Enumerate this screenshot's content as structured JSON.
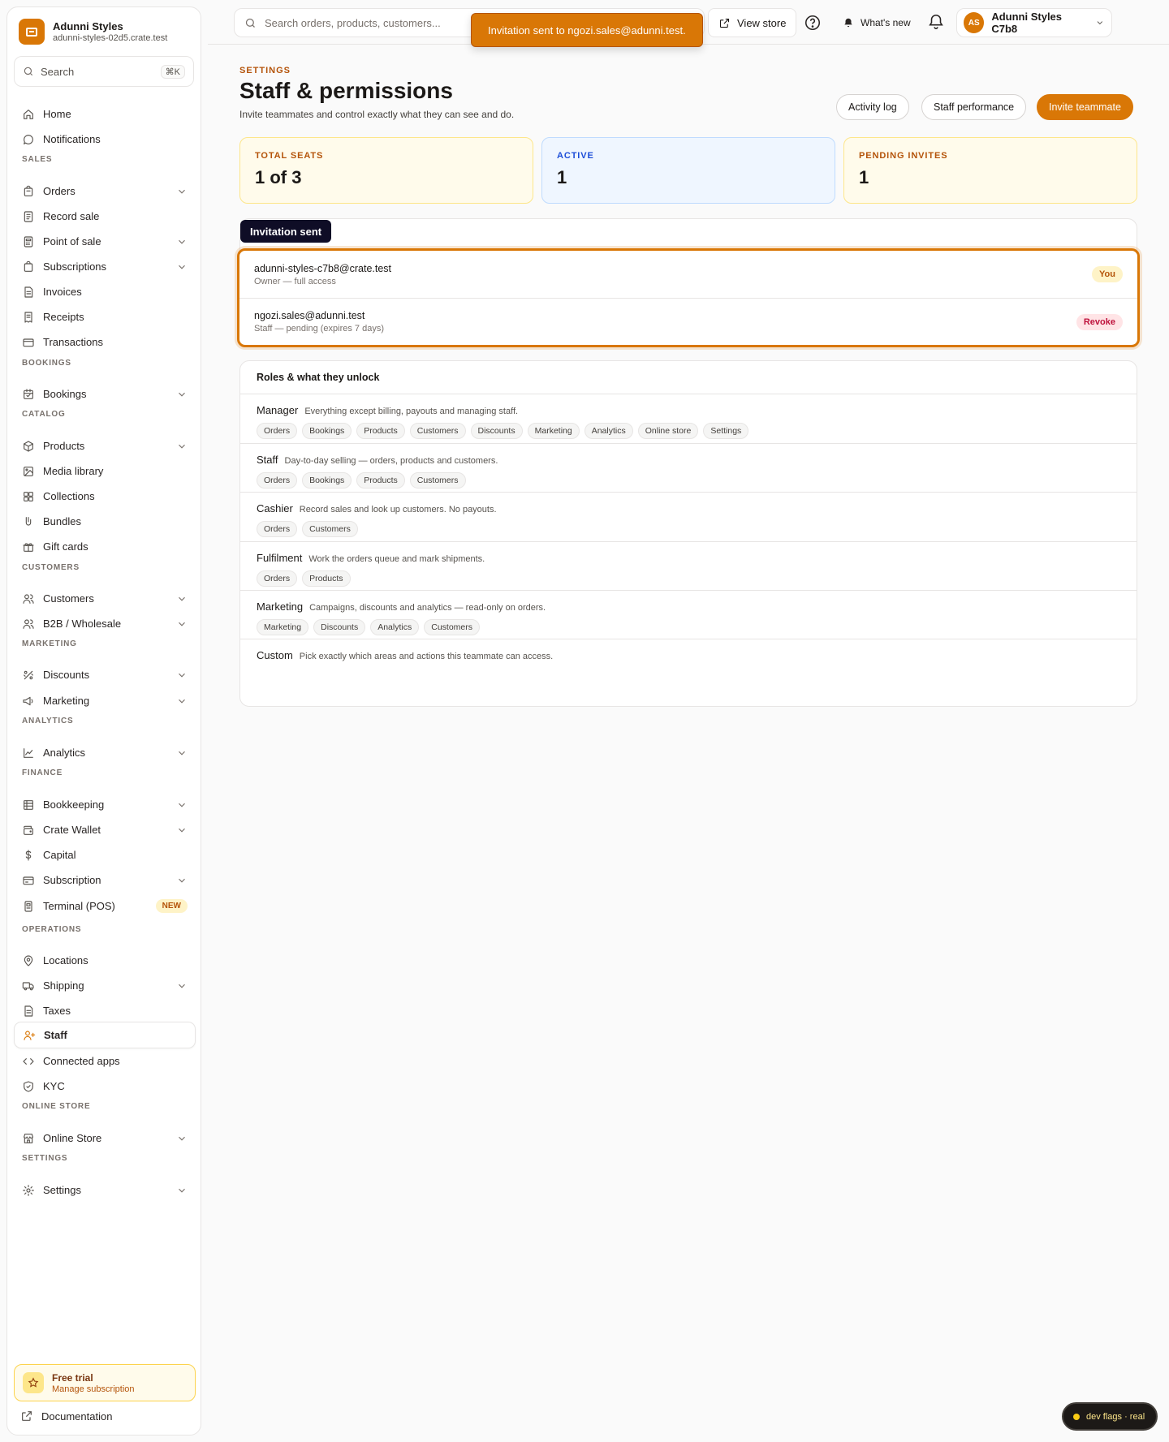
{
  "brand": {
    "name": "Adunni Styles",
    "domain": "adunni-styles-02d5.crate.test"
  },
  "sidebar": {
    "search": {
      "label": "Search",
      "shortcut": "⌘K"
    },
    "items": [
      {
        "label": "Home"
      },
      {
        "label": "Notifications"
      },
      {
        "section": "SALES"
      },
      {
        "label": "Orders"
      },
      {
        "label": "Record sale"
      },
      {
        "label": "Point of sale"
      },
      {
        "label": "Subscriptions"
      },
      {
        "label": "Invoices"
      },
      {
        "label": "Receipts"
      },
      {
        "label": "Transactions"
      },
      {
        "section": "BOOKINGS"
      },
      {
        "label": "Bookings"
      },
      {
        "section": "CATALOG"
      },
      {
        "label": "Products"
      },
      {
        "label": "Media library"
      },
      {
        "label": "Collections"
      },
      {
        "label": "Bundles"
      },
      {
        "label": "Gift cards"
      },
      {
        "section": "CUSTOMERS"
      },
      {
        "label": "Customers"
      },
      {
        "label": "B2B / Wholesale"
      },
      {
        "section": "MARKETING"
      },
      {
        "label": "Discounts"
      },
      {
        "label": "Marketing"
      },
      {
        "section": "ANALYTICS"
      },
      {
        "label": "Analytics"
      },
      {
        "section": "FINANCE"
      },
      {
        "label": "Bookkeeping"
      },
      {
        "label": "Crate Wallet"
      },
      {
        "label": "Capital"
      },
      {
        "label": "Subscription"
      },
      {
        "label": "Terminal (POS)",
        "badge": "NEW"
      },
      {
        "section": "OPERATIONS"
      },
      {
        "label": "Locations"
      },
      {
        "label": "Shipping"
      },
      {
        "label": "Taxes"
      },
      {
        "label": "Staff",
        "active": true
      },
      {
        "label": "Connected apps"
      },
      {
        "label": "KYC"
      },
      {
        "section": "ONLINE STORE"
      },
      {
        "label": "Online Store"
      },
      {
        "section": "SETTINGS"
      },
      {
        "label": "Settings"
      }
    ],
    "trial": {
      "title": "Free trial",
      "subtitle": "Manage subscription"
    },
    "docs": "Documentation"
  },
  "topbar": {
    "search_placeholder": "Search orders, products, customers...",
    "view_store": "View store",
    "whats_new": "What's new",
    "account": {
      "initials": "AS",
      "name": "Adunni Styles C7b8"
    }
  },
  "toast": "Invitation sent to ngozi.sales@adunni.test.",
  "page": {
    "eyebrow": "SETTINGS",
    "title": "Staff & permissions",
    "subtitle": "Invite teammates and control exactly what they can see and do.",
    "actions": {
      "activity": "Activity log",
      "performance": "Staff performance",
      "invite": "Invite teammate"
    }
  },
  "stats": {
    "seats": {
      "label": "TOTAL SEATS",
      "value": "1 of 3"
    },
    "active": {
      "label": "ACTIVE",
      "value": "1"
    },
    "pending": {
      "label": "PENDING INVITES",
      "value": "1"
    }
  },
  "invite_badge": "Invitation sent",
  "members": [
    {
      "email": "adunni-styles-c7b8@crate.test",
      "role": "Owner — full access",
      "tag": "You"
    },
    {
      "email": "ngozi.sales@adunni.test",
      "role": "Staff — pending (expires 7 days)",
      "action": "Revoke"
    }
  ],
  "roles": {
    "heading": "Roles & what they unlock",
    "list": [
      {
        "name": "Manager",
        "desc": "Everything except billing, payouts and managing staff.",
        "chips": [
          "Orders",
          "Bookings",
          "Products",
          "Customers",
          "Discounts",
          "Marketing",
          "Analytics",
          "Online store",
          "Settings"
        ]
      },
      {
        "name": "Staff",
        "desc": "Day-to-day selling — orders, products and customers.",
        "chips": [
          "Orders",
          "Bookings",
          "Products",
          "Customers"
        ]
      },
      {
        "name": "Cashier",
        "desc": "Record sales and look up customers. No payouts.",
        "chips": [
          "Orders",
          "Customers"
        ]
      },
      {
        "name": "Fulfilment",
        "desc": "Work the orders queue and mark shipments.",
        "chips": [
          "Orders",
          "Products"
        ]
      },
      {
        "name": "Marketing",
        "desc": "Campaigns, discounts and analytics — read-only on orders.",
        "chips": [
          "Marketing",
          "Discounts",
          "Analytics",
          "Customers"
        ]
      },
      {
        "name": "Custom",
        "desc": "Pick exactly which areas and actions this teammate can access.",
        "chips": []
      }
    ]
  },
  "dev_flags": "dev flags · real",
  "colors": {
    "accent": "#d97706",
    "badge_dark": "#0f0d26",
    "revoke": "#be123c"
  }
}
